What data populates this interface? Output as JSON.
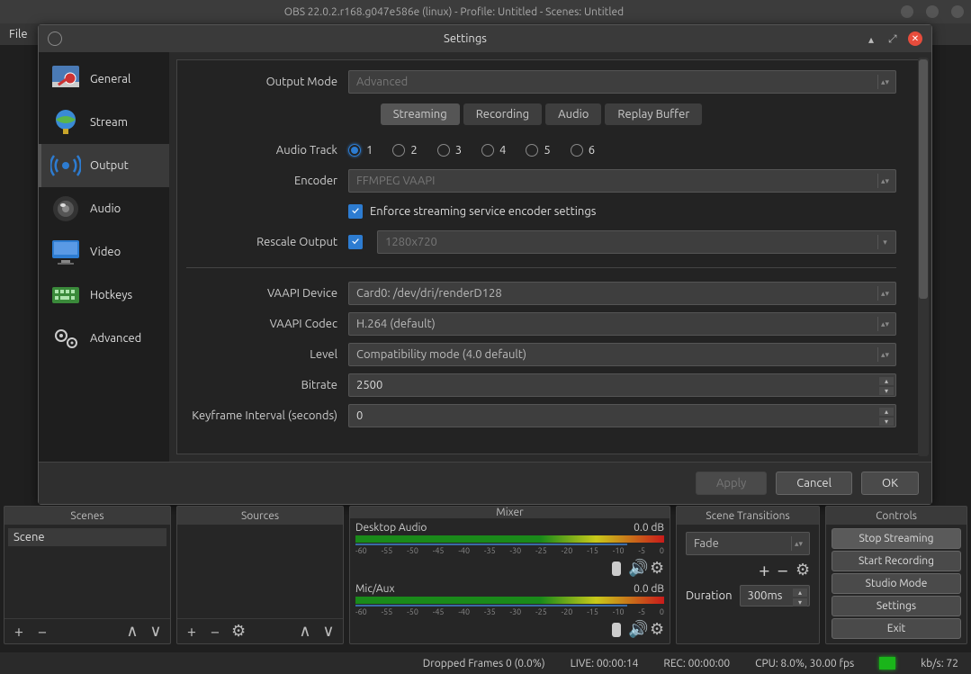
{
  "window_title": "OBS 22.0.2.r168.g047e586e (linux) - Profile: Untitled - Scenes: Untitled",
  "menubar": {
    "file": "File"
  },
  "settings": {
    "title": "Settings",
    "sidebar": {
      "general": "General",
      "stream": "Stream",
      "output": "Output",
      "audio": "Audio",
      "video": "Video",
      "hotkeys": "Hotkeys",
      "advanced": "Advanced"
    },
    "output_mode_label": "Output Mode",
    "output_mode_value": "Advanced",
    "tabs": {
      "streaming": "Streaming",
      "recording": "Recording",
      "audio": "Audio",
      "replay": "Replay Buffer"
    },
    "audio_track_label": "Audio Track",
    "audio_tracks": [
      "1",
      "2",
      "3",
      "4",
      "5",
      "6"
    ],
    "encoder_label": "Encoder",
    "encoder_value": "FFMPEG VAAPI",
    "enforce_label": "Enforce streaming service encoder settings",
    "rescale_label": "Rescale Output",
    "rescale_value": "1280x720",
    "vaapi_device_label": "VAAPI Device",
    "vaapi_device_value": "Card0: /dev/dri/renderD128",
    "vaapi_codec_label": "VAAPI Codec",
    "vaapi_codec_value": "H.264 (default)",
    "level_label": "Level",
    "level_value": "Compatibility mode  (4.0 default)",
    "bitrate_label": "Bitrate",
    "bitrate_value": "2500",
    "keyframe_label": "Keyframe Interval (seconds)",
    "keyframe_value": "0",
    "buttons": {
      "apply": "Apply",
      "cancel": "Cancel",
      "ok": "OK"
    }
  },
  "panels": {
    "scenes": {
      "title": "Scenes",
      "item": "Scene"
    },
    "sources": {
      "title": "Sources"
    },
    "mixer": {
      "title": "Mixer",
      "desktop": {
        "name": "Desktop Audio",
        "level": "0.0 dB"
      },
      "mic": {
        "name": "Mic/Aux",
        "level": "0.0 dB"
      },
      "ticks": [
        "-60",
        "-55",
        "-50",
        "-45",
        "-40",
        "-35",
        "-30",
        "-25",
        "-20",
        "-15",
        "-10",
        "-5",
        "0"
      ]
    },
    "transitions": {
      "title": "Scene Transitions",
      "value": "Fade",
      "duration_label": "Duration",
      "duration_value": "300ms"
    },
    "controls": {
      "title": "Controls",
      "stop_streaming": "Stop Streaming",
      "start_recording": "Start Recording",
      "studio": "Studio Mode",
      "settings": "Settings",
      "exit": "Exit"
    }
  },
  "statusbar": {
    "dropped": "Dropped Frames 0 (0.0%)",
    "live": "LIVE: 00:00:14",
    "rec": "REC: 00:00:00",
    "cpu": "CPU: 8.0%, 30.00 fps",
    "kbps": "kb/s: 72"
  }
}
